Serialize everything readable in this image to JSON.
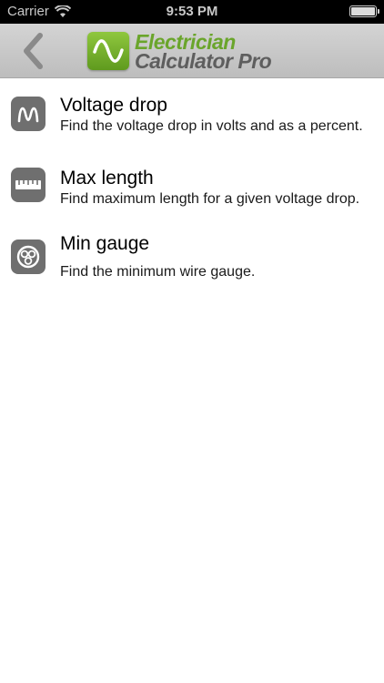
{
  "status": {
    "carrier": "Carrier",
    "time": "9:53 PM"
  },
  "header": {
    "logo_line1": "Electrician",
    "logo_line2": "Calculator Pro"
  },
  "menu": [
    {
      "title": "Voltage drop",
      "description": "Find the voltage drop in volts and as a percent.",
      "icon": "sine-wave-icon"
    },
    {
      "title": "Max length",
      "description": "Find maximum length for a given voltage drop.",
      "icon": "ruler-icon"
    },
    {
      "title": "Min gauge",
      "description": "Find the minimum wire gauge.",
      "icon": "wire-gauge-icon"
    }
  ]
}
